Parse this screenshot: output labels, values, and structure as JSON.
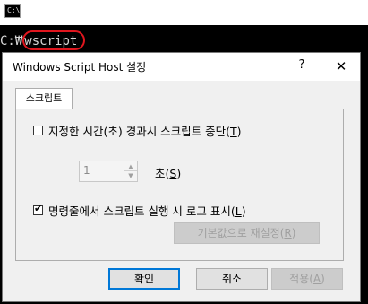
{
  "console": {
    "prompt": "C:\\>",
    "command": "wscript",
    "highlight_color": "#e0161e",
    "prefix": "C:₩"
  },
  "dialog": {
    "title": "Windows Script Host 설정",
    "help_glyph": "?",
    "close_glyph": "✕",
    "tab_label": "스크립트",
    "stop_after_label": "지정한 시간(초) 경과시 스크립트 중단(",
    "stop_after_hotkey": "T",
    "stop_after_checked": false,
    "seconds_value": "1",
    "seconds_label": "초(",
    "seconds_hotkey": "S",
    "logo_label": "명령줄에서 스크립트 실행 시 로고 표시(",
    "logo_hotkey": "L",
    "logo_checked": true,
    "reset_label": "기본값으로 재설정(",
    "reset_hotkey": "R",
    "ok_label": "확인",
    "cancel_label": "취소",
    "apply_label": "적용(",
    "apply_hotkey": "A"
  }
}
